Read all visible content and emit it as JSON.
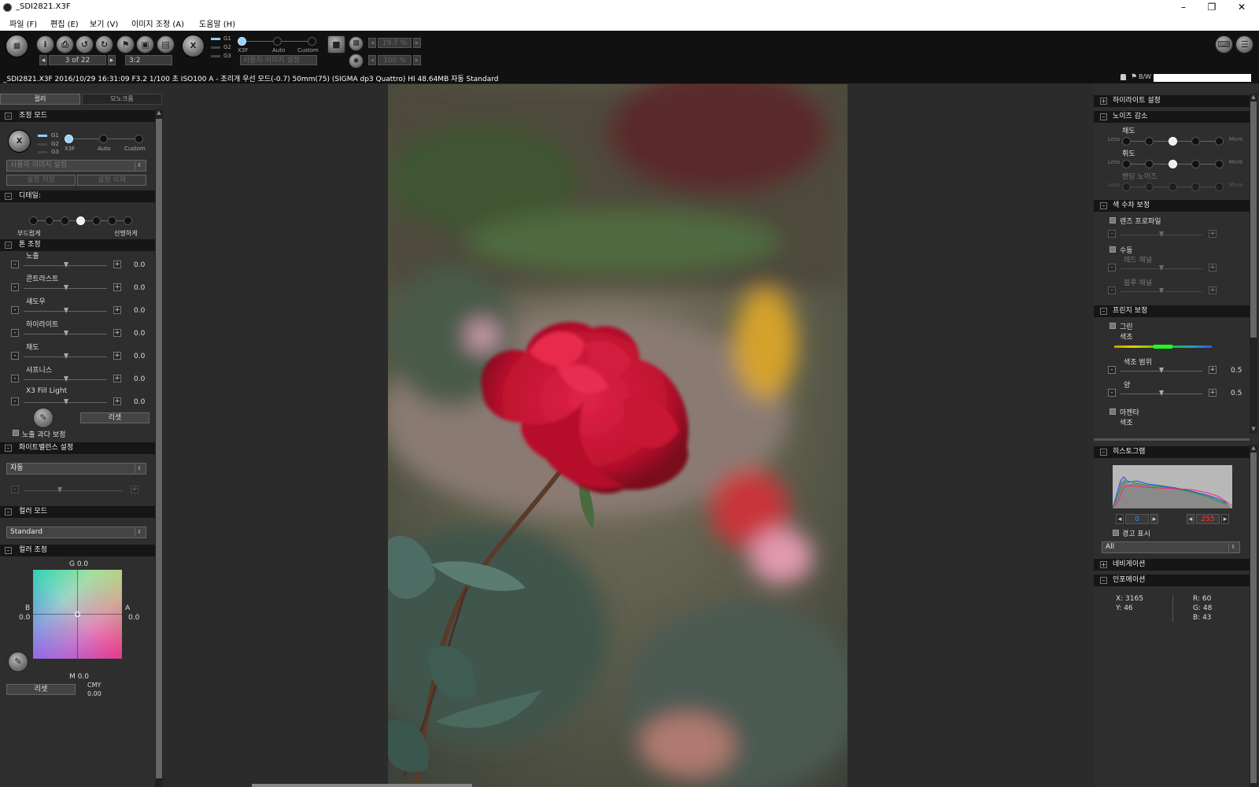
{
  "window": {
    "title": "_SDI2821.X3F"
  },
  "menu": [
    "파일 (F)",
    "편집 (E)",
    "보기 (V)",
    "이미지 조정 (A)",
    "도움말 (H)"
  ],
  "toolbar": {
    "page_counter": "3 of 22",
    "aspect": "3:2",
    "g_labels": [
      "G1",
      "G2",
      "G3"
    ],
    "mode_labels": [
      "X3F",
      "Auto",
      "Custom"
    ],
    "preset_placeholder": "사용자 이미지 설정",
    "zoom1": "19.7 %",
    "zoom2": "100 %"
  },
  "infobar": {
    "text": "_SDI2821.X3F 2016/10/29 16:31:09 F3.2 1/100 초 ISO100 A - 조리개 우선 모드(-0.7) 50mm(75) (SIGMA dp3 Quattro) HI 48.64MB 자동 Standard",
    "bw": "B/W"
  },
  "left": {
    "tabs": [
      "컬러",
      "모노크롬"
    ],
    "adjust_mode": {
      "title": "조정 모드",
      "g_labels": [
        "G1",
        "G2",
        "G3"
      ],
      "mode_labels": [
        "X3F",
        "Auto",
        "Custom"
      ],
      "preset": "사용자 이미지 설정",
      "save_btn": "설정 저장",
      "delete_btn": "설정 삭제"
    },
    "detail": {
      "title": "디테일:",
      "soft": "부드럽게",
      "sharp": "선명하게"
    },
    "tone": {
      "title": "톤 조정",
      "rows": [
        {
          "label": "노출",
          "value": "0.0"
        },
        {
          "label": "콘트라스트",
          "value": "0.0"
        },
        {
          "label": "섀도우",
          "value": "0.0"
        },
        {
          "label": "하이라이트",
          "value": "0.0"
        },
        {
          "label": "채도",
          "value": "0.0"
        },
        {
          "label": "샤프니스",
          "value": "0.0"
        },
        {
          "label": "X3 Fill Light",
          "value": "0.0"
        }
      ],
      "reset": "리셋",
      "overexposure": "노출 과다 보정"
    },
    "wb": {
      "title": "화이트밸런스 설정",
      "value": "자동"
    },
    "color_mode": {
      "title": "컬러 모드",
      "value": "Standard"
    },
    "color_adjust": {
      "title": "컬러 조정",
      "g": "G 0.0",
      "m": "M 0.0",
      "b_label": "B",
      "b_value": "0.0",
      "a_label": "A",
      "a_value": "0.0",
      "reset": "리셋",
      "cmy_label": "CMY",
      "cmy_value": "0.00"
    }
  },
  "right": {
    "highlight": {
      "title": "하이라이트 설정"
    },
    "noise": {
      "title": "노이즈 감소",
      "rows": [
        {
          "label": "채도",
          "less": "Less",
          "more": "More",
          "level": 3
        },
        {
          "label": "휘도",
          "less": "Less",
          "more": "More",
          "level": 3
        },
        {
          "label": "밴딩 노이즈",
          "less": "Less",
          "more": "More",
          "level": 0
        }
      ]
    },
    "chromatic": {
      "title": "색 수차 보정",
      "lens_profile": "렌즈 프로파일",
      "manual": "수동",
      "red": "레드 채널",
      "blue": "블루 채널"
    },
    "fringe": {
      "title": "프린지 보정",
      "green": "그린",
      "hue": "색조",
      "hue_range": "색조 범위",
      "hue_range_val": "0.5",
      "amount": "양",
      "amount_val": "0.5",
      "magenta": "마젠타",
      "hue2": "색조"
    },
    "histogram": {
      "title": "히스토그램",
      "low": "0",
      "high": "255",
      "warning": "경고 표시",
      "channel": "All"
    },
    "navigation": {
      "title": "네비게이션"
    },
    "info": {
      "title": "인포메이션",
      "x": "X: 3165",
      "y": "Y: 46",
      "r": "R: 60",
      "g": "G: 48",
      "b": "B: 43"
    }
  }
}
